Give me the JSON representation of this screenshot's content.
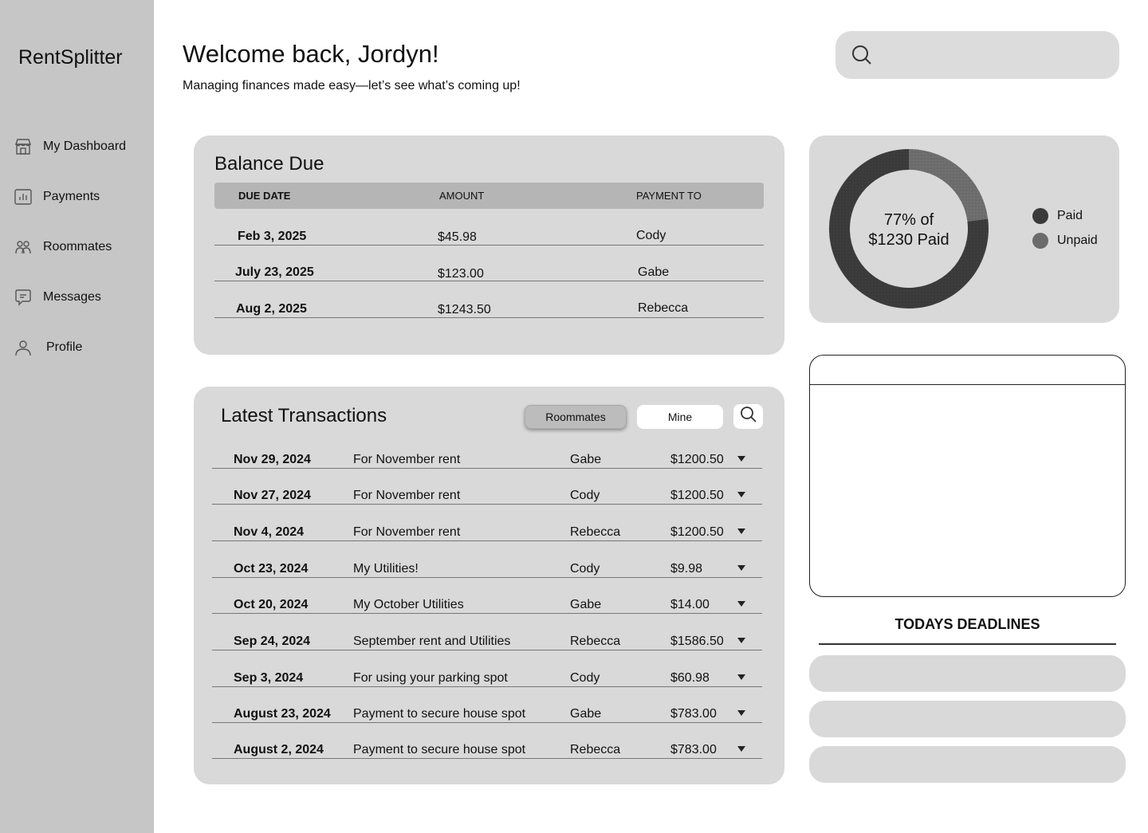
{
  "app": {
    "title": "RentSplitter"
  },
  "sidebar": {
    "items": [
      {
        "label": "My Dashboard",
        "icon": "storefront-icon"
      },
      {
        "label": "Payments",
        "icon": "bar-chart-icon"
      },
      {
        "label": "Roommates",
        "icon": "users-icon"
      },
      {
        "label": "Messages",
        "icon": "message-icon"
      },
      {
        "label": "Profile",
        "icon": "user-icon"
      }
    ]
  },
  "header": {
    "welcome": "Welcome back, Jordyn!",
    "subtitle": "Managing finances made easy—let’s see what’s coming up!",
    "search_placeholder": ""
  },
  "balance_due": {
    "title": "Balance Due",
    "columns": [
      "DUE DATE",
      "AMOUNT",
      "PAYMENT TO"
    ],
    "rows": [
      {
        "date": "Feb 3, 2025",
        "amount": "$45.98",
        "to": "Cody"
      },
      {
        "date": "July 23, 2025",
        "amount": "$123.00",
        "to": "Gabe"
      },
      {
        "date": "Aug 2, 2025",
        "amount": "$1243.50",
        "to": "Rebecca"
      }
    ]
  },
  "transactions": {
    "title": "Latest Transactions",
    "filters": {
      "roommates": "Roommates",
      "mine": "Mine",
      "active": "Roommates"
    },
    "rows": [
      {
        "date": "Nov 29, 2024",
        "desc": "For November rent",
        "name": "Gabe",
        "amount": "$1200.50"
      },
      {
        "date": "Nov 27, 2024",
        "desc": "For November rent",
        "name": "Cody",
        "amount": "$1200.50"
      },
      {
        "date": "Nov 4, 2024",
        "desc": "For November rent",
        "name": "Rebecca",
        "amount": "$1200.50"
      },
      {
        "date": "Oct 23, 2024",
        "desc": "My Utilities!",
        "name": "Cody",
        "amount": "$9.98"
      },
      {
        "date": "Oct 20, 2024",
        "desc": "My October Utilities",
        "name": "Gabe",
        "amount": "$14.00"
      },
      {
        "date": "Sep 24, 2024",
        "desc": "September rent and Utilities",
        "name": "Rebecca",
        "amount": "$1586.50"
      },
      {
        "date": "Sep 3, 2024",
        "desc": "For using your parking spot",
        "name": "Cody",
        "amount": "$60.98"
      },
      {
        "date": "August 23, 2024",
        "desc": "Payment to secure house spot",
        "name": "Gabe",
        "amount": "$783.00"
      },
      {
        "date": "August 2, 2024",
        "desc": "Payment to secure house spot",
        "name": "Rebecca",
        "amount": "$783.00"
      }
    ]
  },
  "summary": {
    "label_line1": "77% of",
    "label_line2": "$1230 Paid",
    "paid_fraction": 0.77,
    "legend": [
      {
        "label": "Paid",
        "color": "#3a3a3a"
      },
      {
        "label": "Unpaid",
        "color": "#6b6b6b"
      }
    ]
  },
  "deadlines": {
    "title": "TODAYS DEADLINES"
  },
  "colors": {
    "sidebar": "#c6c6c6",
    "card": "#d9d9d9",
    "table_header": "#b5b5b5"
  }
}
